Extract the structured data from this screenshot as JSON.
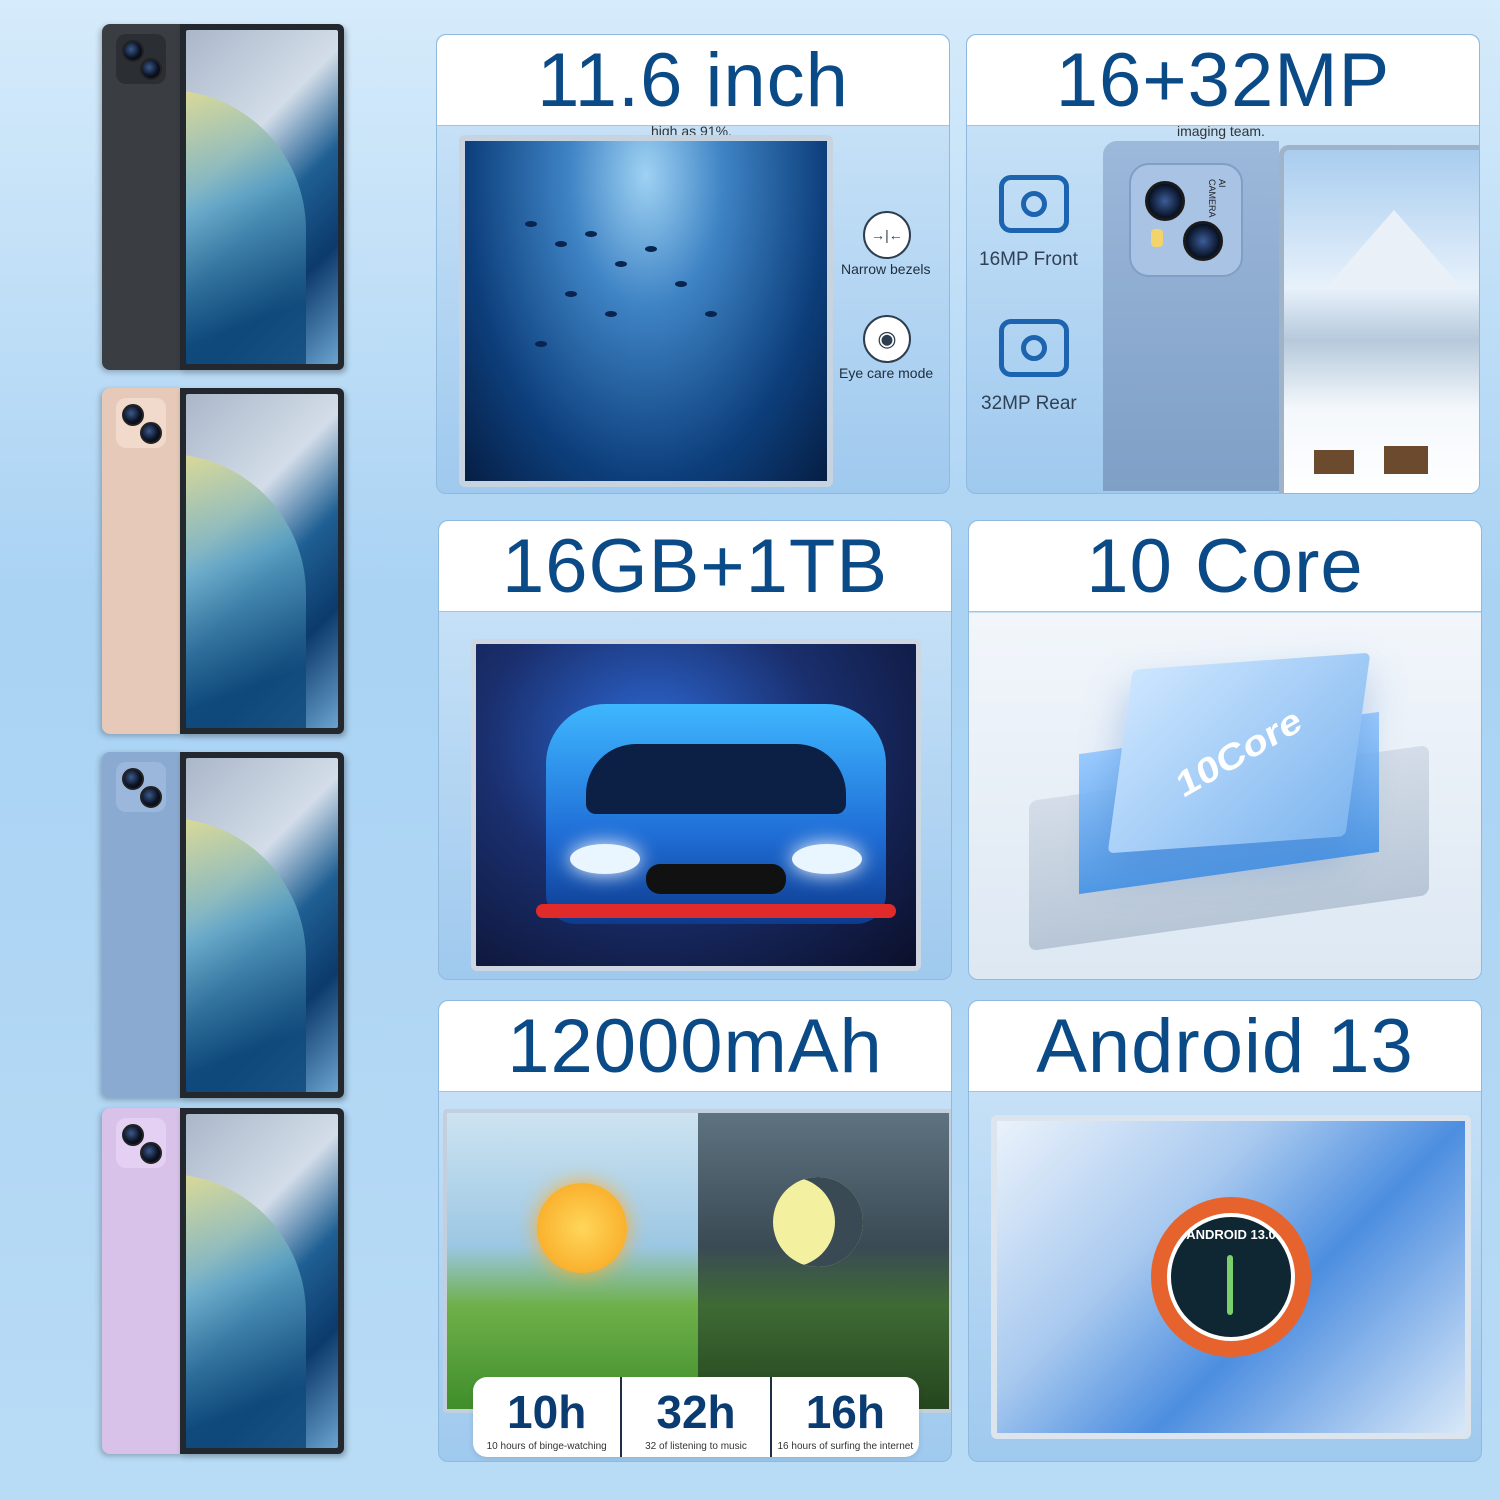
{
  "tablets": [
    {
      "color": "#3a3d42",
      "module": "#2b2e33"
    },
    {
      "color": "#e6c9b8",
      "module": "#f1d9cb"
    },
    {
      "color": "#8aaad1",
      "module": "#9bb8dc"
    },
    {
      "color": "#d8c2ea",
      "module": "#e3d0f2"
    }
  ],
  "panels": {
    "display": {
      "title": "11.6 inch",
      "sub_caption": "high as 91%.",
      "features": [
        {
          "icon": "→|←",
          "label": "Narrow bezels"
        },
        {
          "icon": "◉",
          "label": "Eye care mode"
        }
      ]
    },
    "camera": {
      "title": "16+32MP",
      "sub_caption": "imaging team.",
      "front_label": "16MP Front",
      "rear_label": "32MP Rear",
      "module_label": "AI CAMERA"
    },
    "memory": {
      "title": "16GB+1TB"
    },
    "cpu": {
      "title": "10 Core",
      "chip_label": "10Core"
    },
    "battery": {
      "title": "12000mAh",
      "stats": [
        {
          "value": "10h",
          "caption": "10 hours of binge-watching"
        },
        {
          "value": "32h",
          "caption": "32 of listening to music"
        },
        {
          "value": "16h",
          "caption": "16 hours of surfing the internet"
        }
      ]
    },
    "os": {
      "title": "Android 13",
      "badge": "ANDROID 13.0"
    }
  }
}
